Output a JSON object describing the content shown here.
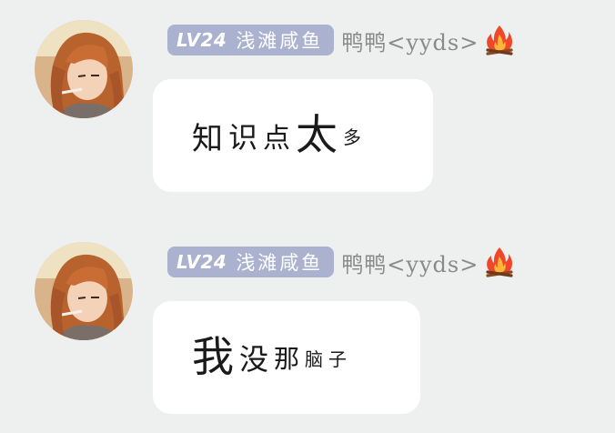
{
  "messages": [
    {
      "level": "LV24",
      "title": "浅滩咸鱼",
      "username": "鸭鸭<yyds>",
      "avatar_icon": "anime-girl-avatar",
      "flame_icon": "campfire-icon",
      "text_chars": [
        "知",
        "识",
        "点",
        "太",
        "多"
      ]
    },
    {
      "level": "LV24",
      "title": "浅滩咸鱼",
      "username": "鸭鸭<yyds>",
      "avatar_icon": "anime-girl-avatar",
      "flame_icon": "campfire-icon",
      "text_chars": [
        "我",
        "没",
        "那",
        "脑",
        "子"
      ]
    }
  ],
  "colors": {
    "background": "#eef0ef",
    "badge": "#aab2cf",
    "username": "#8a8a8a",
    "bubble": "#ffffff"
  }
}
